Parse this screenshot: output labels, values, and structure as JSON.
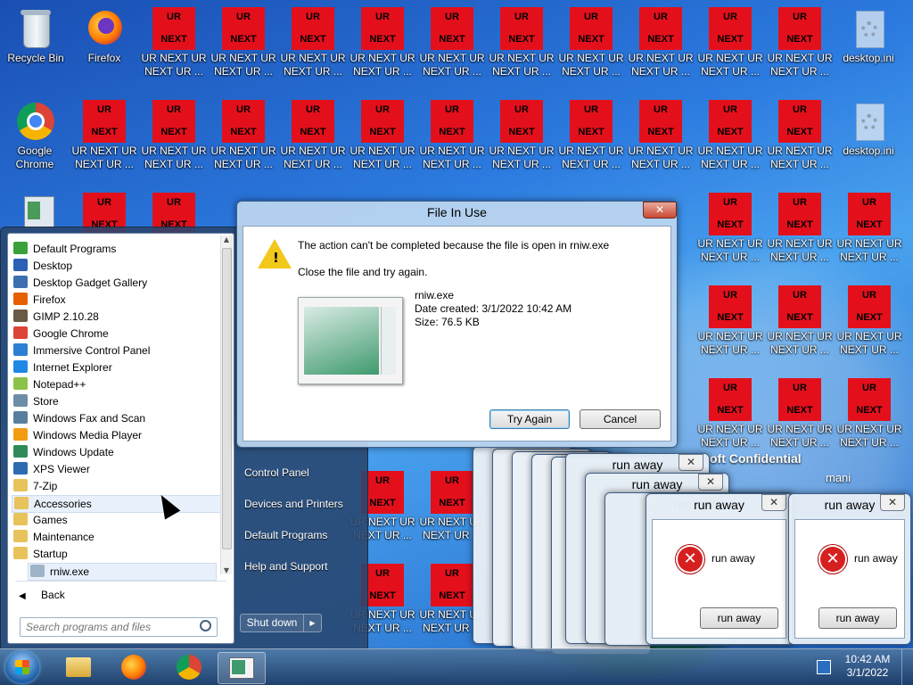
{
  "desktop": {
    "icons": [
      {
        "label": "Recycle Bin"
      },
      {
        "label": "Firefox"
      },
      {
        "label": "Google Chrome"
      },
      {
        "label": "desktop.ini"
      },
      {
        "label": "desktop.ini"
      }
    ],
    "ur_icon": {
      "top": "UR",
      "bottom": "NEXT",
      "label_line1": "UR NEXT UR",
      "label_line2": "NEXT UR ..."
    },
    "wallpaper_text": "oft Confidential",
    "wallpaper_text2": "mani"
  },
  "file_in_use": {
    "title": "File In Use",
    "close": "✕",
    "message": "The action can't be completed because the file is open in rniw.exe",
    "instruction": "Close the file and try again.",
    "file_name": "rniw.exe",
    "date_created": "Date created: 3/1/2022 10:42 AM",
    "size": "Size: 76.5 KB",
    "try_again": "Try Again",
    "cancel": "Cancel"
  },
  "run_away": {
    "title": "run away",
    "message": "run away",
    "button": "run away",
    "close": "✕"
  },
  "start_menu": {
    "programs": [
      {
        "label": "Default Programs",
        "color": "#3aa13a"
      },
      {
        "label": "Desktop",
        "color": "#2b62b4"
      },
      {
        "label": "Desktop Gadget Gallery",
        "color": "#3d6fb0"
      },
      {
        "label": "Firefox",
        "color": "#e66000"
      },
      {
        "label": "GIMP 2.10.28",
        "color": "#6b5b45"
      },
      {
        "label": "Google Chrome",
        "color": "#db4437"
      },
      {
        "label": "Immersive Control Panel",
        "color": "#2c7fd2"
      },
      {
        "label": "Internet Explorer",
        "color": "#1e88e5"
      },
      {
        "label": "Notepad++",
        "color": "#8bc34a"
      },
      {
        "label": "Store",
        "color": "#6e8ea8"
      },
      {
        "label": "Windows Fax and Scan",
        "color": "#5a7f9e"
      },
      {
        "label": "Windows Media Player",
        "color": "#f39c12"
      },
      {
        "label": "Windows Update",
        "color": "#2e8b57"
      },
      {
        "label": "XPS Viewer",
        "color": "#2b6cb0"
      },
      {
        "label": "7-Zip",
        "color": "#e8c25a"
      },
      {
        "label": "Accessories",
        "color": "#e8c25a"
      },
      {
        "label": "Games",
        "color": "#e8c25a"
      },
      {
        "label": "Maintenance",
        "color": "#e8c25a"
      },
      {
        "label": "Startup",
        "color": "#e8c25a"
      },
      {
        "label": "rniw.exe",
        "color": "#9fb4c8"
      }
    ],
    "back": "Back",
    "search_placeholder": "Search programs and files",
    "right_items": [
      "Control Panel",
      "Devices and Printers",
      "Default Programs",
      "Help and Support"
    ],
    "shutdown": "Shut down",
    "shutdown_arrow": "▶"
  },
  "taskbar": {
    "time": "10:42 AM",
    "date": "3/1/2022"
  }
}
